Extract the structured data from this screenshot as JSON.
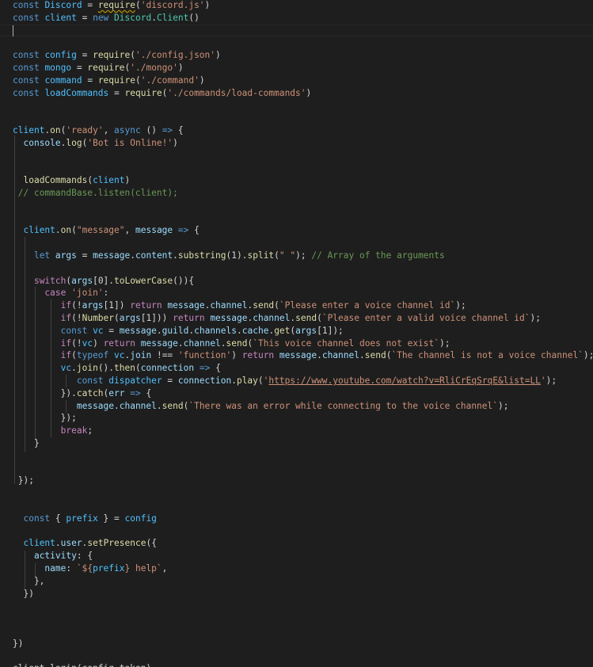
{
  "editor": {
    "lines": [
      [
        [
          "kw",
          "const"
        ],
        [
          "pl",
          " "
        ],
        [
          "const",
          "Discord"
        ],
        [
          "pl",
          " = "
        ],
        [
          "fn",
          "require",
          "squig"
        ],
        [
          "pl",
          "("
        ],
        [
          "str",
          "'discord.js'"
        ],
        [
          "pl",
          ")"
        ]
      ],
      [
        [
          "kw",
          "const"
        ],
        [
          "pl",
          " "
        ],
        [
          "const",
          "client"
        ],
        [
          "pl",
          " = "
        ],
        [
          "kw",
          "new"
        ],
        [
          "pl",
          " "
        ],
        [
          "cls",
          "Discord"
        ],
        [
          "pl",
          "."
        ],
        [
          "cls",
          "Client"
        ],
        [
          "pl",
          "()"
        ]
      ],
      [],
      [],
      [
        [
          "kw",
          "const"
        ],
        [
          "pl",
          " "
        ],
        [
          "const",
          "config"
        ],
        [
          "pl",
          " = "
        ],
        [
          "fn",
          "require"
        ],
        [
          "pl",
          "("
        ],
        [
          "str",
          "'./config.json'"
        ],
        [
          "pl",
          ")"
        ]
      ],
      [
        [
          "kw",
          "const"
        ],
        [
          "pl",
          " "
        ],
        [
          "const",
          "mongo"
        ],
        [
          "pl",
          " = "
        ],
        [
          "fn",
          "require"
        ],
        [
          "pl",
          "("
        ],
        [
          "str",
          "'./mongo'"
        ],
        [
          "pl",
          ")"
        ]
      ],
      [
        [
          "kw",
          "const"
        ],
        [
          "pl",
          " "
        ],
        [
          "const",
          "command"
        ],
        [
          "pl",
          " = "
        ],
        [
          "fn",
          "require"
        ],
        [
          "pl",
          "("
        ],
        [
          "str",
          "'./command'"
        ],
        [
          "pl",
          ")"
        ]
      ],
      [
        [
          "kw",
          "const"
        ],
        [
          "pl",
          " "
        ],
        [
          "const",
          "loadCommands"
        ],
        [
          "pl",
          " = "
        ],
        [
          "fn",
          "require"
        ],
        [
          "pl",
          "("
        ],
        [
          "str",
          "'./commands/load-commands'"
        ],
        [
          "pl",
          ")"
        ]
      ],
      [],
      [],
      [
        [
          "const",
          "client"
        ],
        [
          "pl",
          "."
        ],
        [
          "fn",
          "on"
        ],
        [
          "pl",
          "("
        ],
        [
          "str",
          "'ready'"
        ],
        [
          "pl",
          ", "
        ],
        [
          "kw",
          "async"
        ],
        [
          "pl",
          " () "
        ],
        [
          "kw",
          "=>"
        ],
        [
          "pl",
          " {"
        ]
      ],
      [
        [
          "pl",
          "  "
        ],
        [
          "var",
          "console"
        ],
        [
          "pl",
          "."
        ],
        [
          "fn",
          "log"
        ],
        [
          "pl",
          "("
        ],
        [
          "str",
          "'Bot is Online!'"
        ],
        [
          "pl",
          ")"
        ]
      ],
      [],
      [],
      [
        [
          "pl",
          "  "
        ],
        [
          "fn",
          "loadCommands"
        ],
        [
          "pl",
          "("
        ],
        [
          "const",
          "client"
        ],
        [
          "pl",
          ")"
        ]
      ],
      [
        [
          "pl",
          " "
        ],
        [
          "cmt",
          "// commandBase.listen(client);"
        ]
      ],
      [],
      [],
      [
        [
          "pl",
          "  "
        ],
        [
          "const",
          "client"
        ],
        [
          "pl",
          "."
        ],
        [
          "fn",
          "on"
        ],
        [
          "pl",
          "("
        ],
        [
          "str",
          "\"message\""
        ],
        [
          "pl",
          ", "
        ],
        [
          "var",
          "message"
        ],
        [
          "pl",
          " "
        ],
        [
          "kw",
          "=>"
        ],
        [
          "pl",
          " {"
        ]
      ],
      [],
      [
        [
          "pl",
          "    "
        ],
        [
          "kw",
          "let"
        ],
        [
          "pl",
          " "
        ],
        [
          "var",
          "args"
        ],
        [
          "pl",
          " = "
        ],
        [
          "var",
          "message"
        ],
        [
          "pl",
          "."
        ],
        [
          "var",
          "content"
        ],
        [
          "pl",
          "."
        ],
        [
          "fn",
          "substring"
        ],
        [
          "pl",
          "(1)."
        ],
        [
          "fn",
          "split"
        ],
        [
          "pl",
          "("
        ],
        [
          "str",
          "\" \""
        ],
        [
          "pl",
          "); "
        ],
        [
          "cmt",
          "// Array of the arguments"
        ]
      ],
      [],
      [
        [
          "pl",
          "    "
        ],
        [
          "ctl",
          "switch"
        ],
        [
          "pl",
          "("
        ],
        [
          "var",
          "args"
        ],
        [
          "pl",
          "[0]."
        ],
        [
          "fn",
          "toLowerCase"
        ],
        [
          "pl",
          "()){"
        ]
      ],
      [
        [
          "pl",
          "      "
        ],
        [
          "ctl",
          "case"
        ],
        [
          "pl",
          " "
        ],
        [
          "str",
          "'join'"
        ],
        [
          "pl",
          ":"
        ]
      ],
      [
        [
          "pl",
          "         "
        ],
        [
          "ctl",
          "if"
        ],
        [
          "pl",
          "(!"
        ],
        [
          "var",
          "args"
        ],
        [
          "pl",
          "[1]) "
        ],
        [
          "ctl",
          "return"
        ],
        [
          "pl",
          " "
        ],
        [
          "var",
          "message"
        ],
        [
          "pl",
          "."
        ],
        [
          "var",
          "channel"
        ],
        [
          "pl",
          "."
        ],
        [
          "fn",
          "send"
        ],
        [
          "pl",
          "("
        ],
        [
          "str",
          "`Please enter a voice channel id`"
        ],
        [
          "pl",
          ");"
        ]
      ],
      [
        [
          "pl",
          "         "
        ],
        [
          "ctl",
          "if"
        ],
        [
          "pl",
          "(!"
        ],
        [
          "fn",
          "Number"
        ],
        [
          "pl",
          "("
        ],
        [
          "var",
          "args"
        ],
        [
          "pl",
          "[1])) "
        ],
        [
          "ctl",
          "return"
        ],
        [
          "pl",
          " "
        ],
        [
          "var",
          "message"
        ],
        [
          "pl",
          "."
        ],
        [
          "var",
          "channel"
        ],
        [
          "pl",
          "."
        ],
        [
          "fn",
          "send"
        ],
        [
          "pl",
          "("
        ],
        [
          "str",
          "`Please enter a valid voice channel id`"
        ],
        [
          "pl",
          ");"
        ]
      ],
      [
        [
          "pl",
          "         "
        ],
        [
          "kw",
          "const"
        ],
        [
          "pl",
          " "
        ],
        [
          "const",
          "vc"
        ],
        [
          "pl",
          " = "
        ],
        [
          "var",
          "message"
        ],
        [
          "pl",
          "."
        ],
        [
          "var",
          "guild"
        ],
        [
          "pl",
          "."
        ],
        [
          "var",
          "channels"
        ],
        [
          "pl",
          "."
        ],
        [
          "var",
          "cache"
        ],
        [
          "pl",
          "."
        ],
        [
          "fn",
          "get"
        ],
        [
          "pl",
          "("
        ],
        [
          "var",
          "args"
        ],
        [
          "pl",
          "[1]);"
        ]
      ],
      [
        [
          "pl",
          "         "
        ],
        [
          "ctl",
          "if"
        ],
        [
          "pl",
          "(!"
        ],
        [
          "const",
          "vc"
        ],
        [
          "pl",
          ") "
        ],
        [
          "ctl",
          "return"
        ],
        [
          "pl",
          " "
        ],
        [
          "var",
          "message"
        ],
        [
          "pl",
          "."
        ],
        [
          "var",
          "channel"
        ],
        [
          "pl",
          "."
        ],
        [
          "fn",
          "send"
        ],
        [
          "pl",
          "("
        ],
        [
          "str",
          "`This voice channel does not exist`"
        ],
        [
          "pl",
          ");"
        ]
      ],
      [
        [
          "pl",
          "         "
        ],
        [
          "ctl",
          "if"
        ],
        [
          "pl",
          "("
        ],
        [
          "kw",
          "typeof"
        ],
        [
          "pl",
          " "
        ],
        [
          "const",
          "vc"
        ],
        [
          "pl",
          "."
        ],
        [
          "var",
          "join"
        ],
        [
          "pl",
          " !== "
        ],
        [
          "str",
          "'function'"
        ],
        [
          "pl",
          ") "
        ],
        [
          "ctl",
          "return"
        ],
        [
          "pl",
          " "
        ],
        [
          "var",
          "message"
        ],
        [
          "pl",
          "."
        ],
        [
          "var",
          "channel"
        ],
        [
          "pl",
          "."
        ],
        [
          "fn",
          "send"
        ],
        [
          "pl",
          "("
        ],
        [
          "str",
          "`The channel is not a voice channel`"
        ],
        [
          "pl",
          ");"
        ]
      ],
      [
        [
          "pl",
          "         "
        ],
        [
          "const",
          "vc"
        ],
        [
          "pl",
          "."
        ],
        [
          "fn",
          "join"
        ],
        [
          "pl",
          "()."
        ],
        [
          "fn",
          "then"
        ],
        [
          "pl",
          "("
        ],
        [
          "var",
          "connection"
        ],
        [
          "pl",
          " "
        ],
        [
          "kw",
          "=>"
        ],
        [
          "pl",
          " {"
        ]
      ],
      [
        [
          "pl",
          "            "
        ],
        [
          "kw",
          "const"
        ],
        [
          "pl",
          " "
        ],
        [
          "const",
          "dispatcher"
        ],
        [
          "pl",
          " = "
        ],
        [
          "var",
          "connection"
        ],
        [
          "pl",
          "."
        ],
        [
          "fn",
          "play"
        ],
        [
          "pl",
          "("
        ],
        [
          "str",
          "'"
        ],
        [
          "str",
          "https://www.youtube.com/watch?v=RliCrEqSrqE&list=LL",
          "url"
        ],
        [
          "str",
          "'"
        ],
        [
          "pl",
          ");"
        ]
      ],
      [
        [
          "pl",
          "         "
        ],
        [
          "pl",
          "})."
        ],
        [
          "fn",
          "catch"
        ],
        [
          "pl",
          "("
        ],
        [
          "var",
          "err"
        ],
        [
          "pl",
          " "
        ],
        [
          "kw",
          "=>"
        ],
        [
          "pl",
          " {"
        ]
      ],
      [
        [
          "pl",
          "            "
        ],
        [
          "var",
          "message"
        ],
        [
          "pl",
          "."
        ],
        [
          "var",
          "channel"
        ],
        [
          "pl",
          "."
        ],
        [
          "fn",
          "send"
        ],
        [
          "pl",
          "("
        ],
        [
          "str",
          "`There was an error while connecting to the voice channel`"
        ],
        [
          "pl",
          ");"
        ]
      ],
      [
        [
          "pl",
          "         "
        ],
        [
          "pl",
          "});"
        ]
      ],
      [
        [
          "pl",
          "         "
        ],
        [
          "ctl",
          "break"
        ],
        [
          "pl",
          ";"
        ]
      ],
      [
        [
          "pl",
          "    }"
        ]
      ],
      [],
      [],
      [
        [
          "pl",
          " });"
        ]
      ],
      [],
      [],
      [
        [
          "pl",
          "  "
        ],
        [
          "kw",
          "const"
        ],
        [
          "pl",
          " { "
        ],
        [
          "const",
          "prefix"
        ],
        [
          "pl",
          " } = "
        ],
        [
          "const",
          "config"
        ]
      ],
      [],
      [
        [
          "pl",
          "  "
        ],
        [
          "const",
          "client"
        ],
        [
          "pl",
          "."
        ],
        [
          "var",
          "user"
        ],
        [
          "pl",
          "."
        ],
        [
          "fn",
          "setPresence"
        ],
        [
          "pl",
          "({"
        ]
      ],
      [
        [
          "pl",
          "    "
        ],
        [
          "var",
          "activity"
        ],
        [
          "pl",
          ": {"
        ]
      ],
      [
        [
          "pl",
          "      "
        ],
        [
          "var",
          "name"
        ],
        [
          "pl",
          ": "
        ],
        [
          "str",
          "`${"
        ],
        [
          "const",
          "prefix"
        ],
        [
          "str",
          "} help`"
        ],
        [
          "pl",
          ","
        ]
      ],
      [
        [
          "pl",
          "    },"
        ]
      ],
      [
        [
          "pl",
          "  })"
        ]
      ],
      [],
      [],
      [],
      [
        [
          "pl",
          "})"
        ]
      ],
      [],
      [
        [
          "pl",
          "client.login(config.token)"
        ]
      ]
    ]
  }
}
